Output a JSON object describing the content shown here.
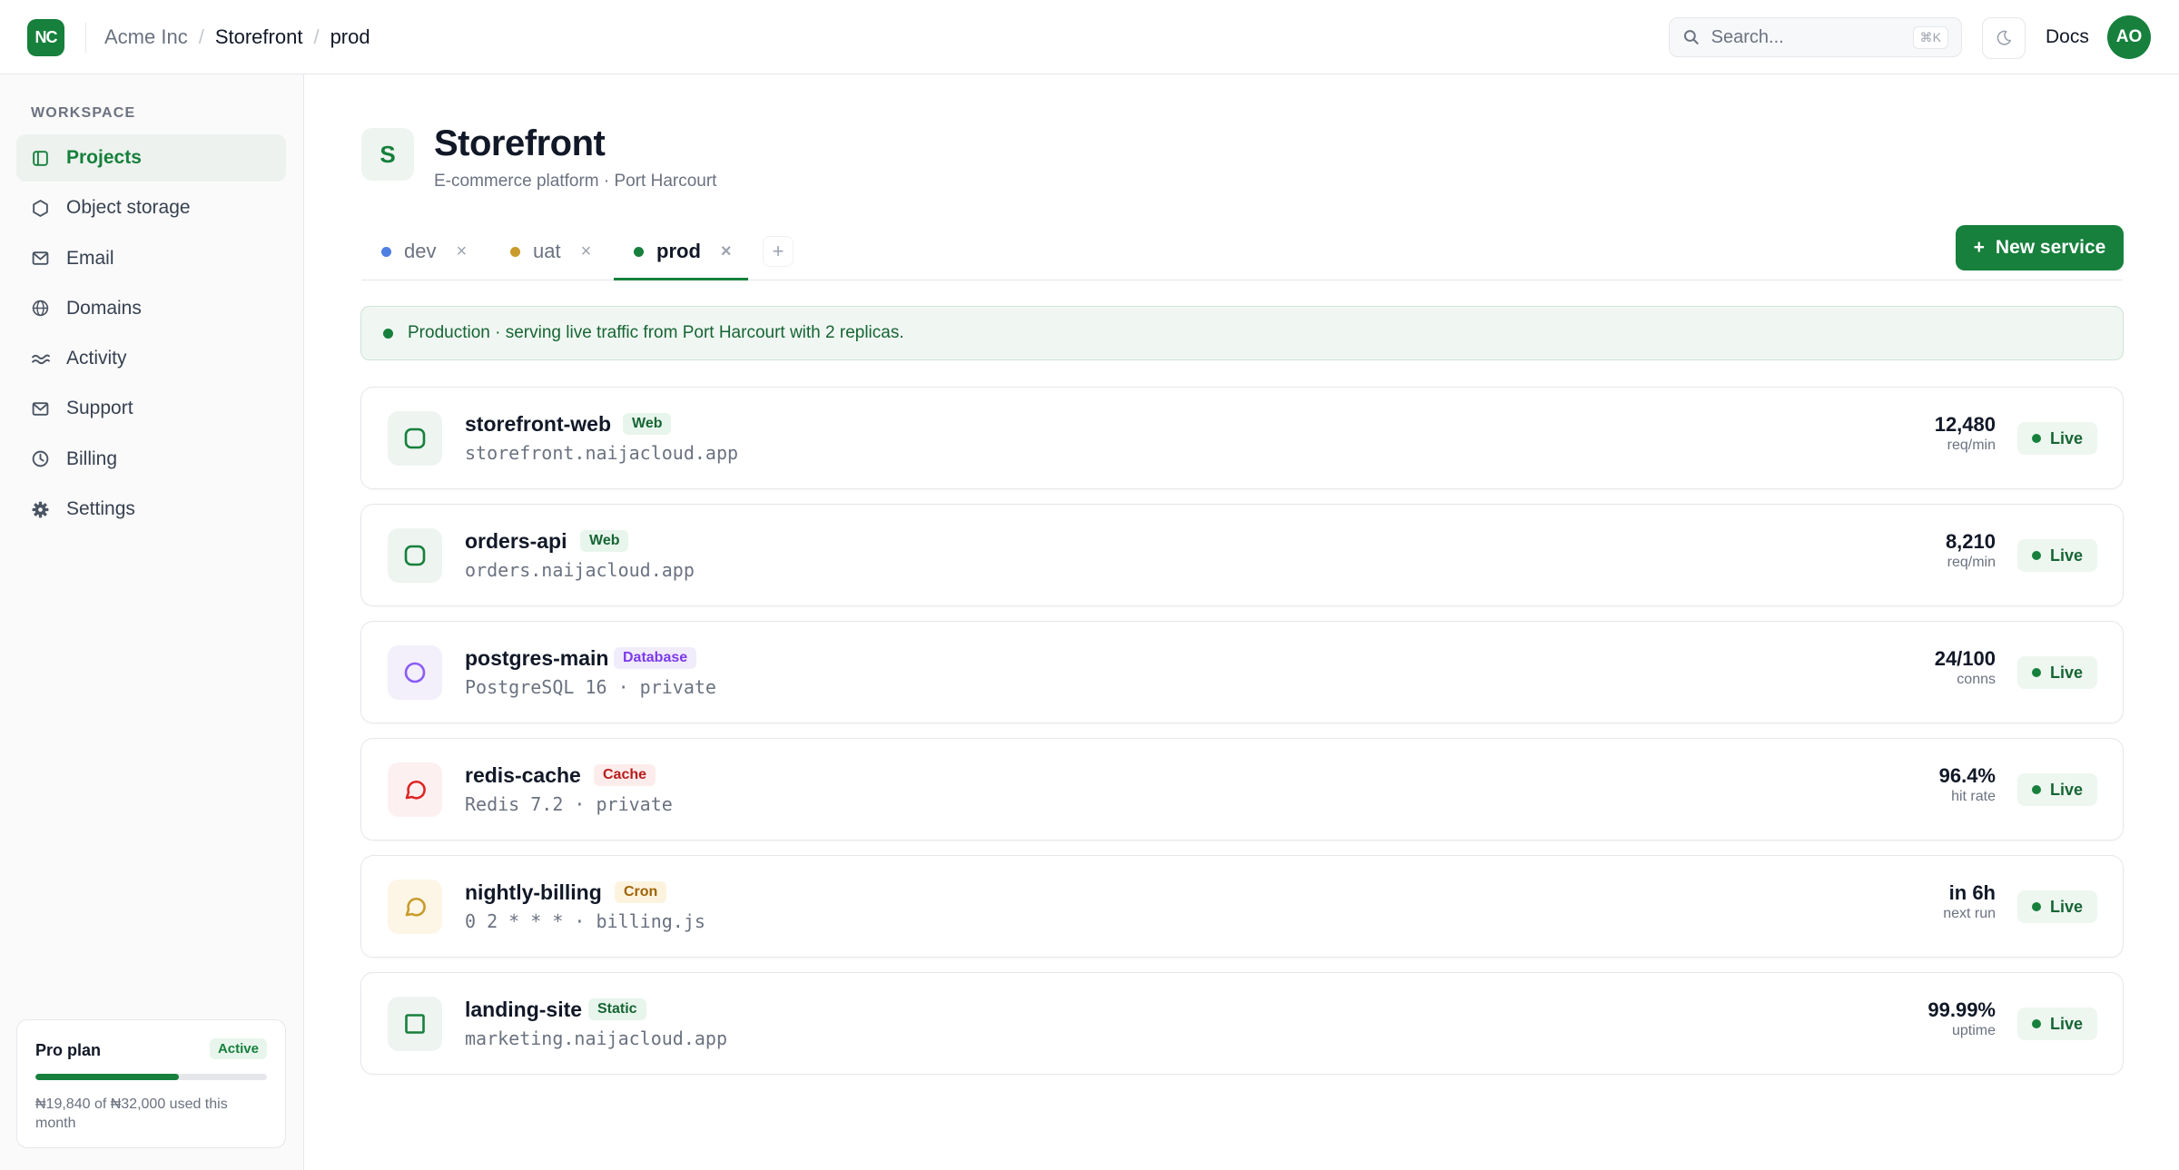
{
  "app": {
    "logo_text": "NC",
    "brand_color": "#16803c"
  },
  "breadcrumb": {
    "org": "Acme Inc",
    "sep1": "/",
    "project": "Storefront",
    "sep2": "/",
    "env": "prod"
  },
  "search": {
    "placeholder": "Search...",
    "shortcut": "⌘K",
    "icon": "search-icon"
  },
  "header": {
    "theme_icon": "moon-icon",
    "docs_label": "Docs",
    "avatar_initials": "AO"
  },
  "sidebar": {
    "section_label": "WORKSPACE",
    "items": [
      {
        "label": "Projects",
        "icon": "folder-icon",
        "active": true
      },
      {
        "label": "Object storage",
        "icon": "hexagon-icon"
      },
      {
        "label": "Email",
        "icon": "mail-icon"
      },
      {
        "label": "Domains",
        "icon": "globe-icon"
      },
      {
        "label": "Activity",
        "icon": "wave-icon"
      },
      {
        "label": "Support",
        "icon": "mail-icon"
      },
      {
        "label": "Billing",
        "icon": "clock-icon"
      },
      {
        "label": "Settings",
        "icon": "gear-icon"
      }
    ],
    "plan": {
      "name": "Pro plan",
      "status": "Active",
      "usage_fraction": 0.62,
      "usage_text": "₦19,840 of ₦32,000 used this month"
    }
  },
  "project": {
    "initial": "S",
    "title": "Storefront",
    "subtitle": "E-commerce platform · Port Harcourt"
  },
  "tabs": [
    {
      "label": "dev",
      "color": "#4f7fe0",
      "close": "×"
    },
    {
      "label": "uat",
      "color": "#c89b2b",
      "close": "×"
    },
    {
      "label": "prod",
      "color": "#16803c",
      "close": "×",
      "active": true
    }
  ],
  "tab_add_label": "+",
  "new_service": {
    "icon": "+",
    "label": "New service"
  },
  "banner": {
    "text": "Production · serving live traffic from Port Harcourt with 2 replicas."
  },
  "services": [
    {
      "name": "storefront-web",
      "tag": "Web",
      "host": "storefront.naijacloud.app",
      "metric_value": "12,480",
      "metric_unit": "req/min",
      "status": "Live"
    },
    {
      "name": "orders-api",
      "tag": "Web",
      "host": "orders.naijacloud.app",
      "metric_value": "8,210",
      "metric_unit": "req/min",
      "status": "Live"
    },
    {
      "name": "postgres-main",
      "tag": "Database",
      "host": "PostgreSQL 16 · private",
      "metric_value": "24/100",
      "metric_unit": "conns",
      "status": "Live"
    },
    {
      "name": "redis-cache",
      "tag": "Cache",
      "host": "Redis 7.2 · private",
      "metric_value": "96.4%",
      "metric_unit": "hit rate",
      "status": "Live"
    },
    {
      "name": "nightly-billing",
      "tag": "Cron",
      "host": "0 2 * * * · billing.js",
      "metric_value": "in 6h",
      "metric_unit": "next run",
      "status": "Live"
    },
    {
      "name": "landing-site",
      "tag": "Static",
      "host": "marketing.naijacloud.app",
      "metric_value": "99.99%",
      "metric_unit": "uptime",
      "status": "Live"
    }
  ]
}
